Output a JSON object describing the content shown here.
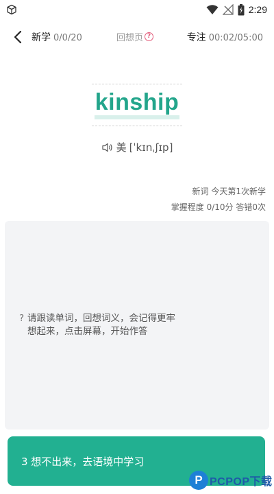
{
  "status_bar": {
    "time": "2:29",
    "icons": [
      "cube-icon",
      "wifi-icon",
      "no-signal-icon",
      "battery-icon"
    ]
  },
  "header": {
    "new_label": "新学",
    "new_count": "0/0/20",
    "recall_label": "回想页",
    "recall_help": "?",
    "focus_label": "专注",
    "focus_time": "00:02/05:00",
    "back_icon": "chevron-left-icon"
  },
  "word": {
    "text": "kinship",
    "pron_prefix": "美",
    "phonetic": "[ˈkɪnˌʃɪp]",
    "sound_icon": "speaker-icon"
  },
  "stats": {
    "line1": "新词 今天第1次新学",
    "line2": "掌握程度 0/10分 答错0次"
  },
  "hint": {
    "mark": "?",
    "line1": "请跟读单词，回想词义，会记得更牢",
    "line2": "想起来，点击屏幕，开始作答"
  },
  "cta": {
    "label": "3  想不出来，去语境中学习"
  },
  "watermark": {
    "logo_letter": "P",
    "text": "PCPOP下载"
  },
  "colors": {
    "accent": "#22b091",
    "word": "#23a58b",
    "help": "#e25b7a",
    "card": "#f3f4f6"
  }
}
